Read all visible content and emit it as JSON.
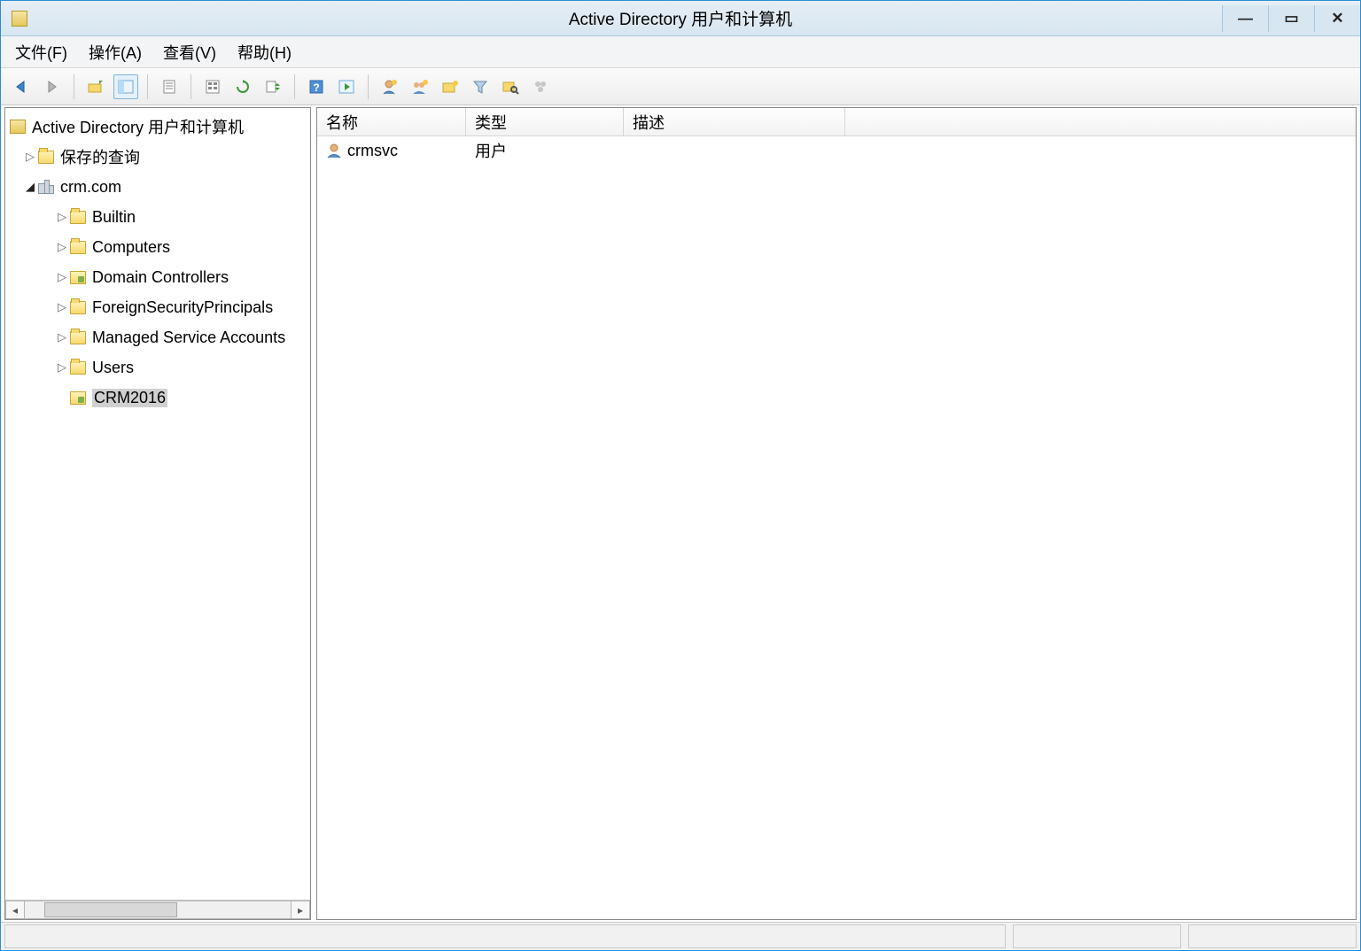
{
  "window": {
    "title": "Active Directory 用户和计算机"
  },
  "menu": {
    "file": "文件(F)",
    "action": "操作(A)",
    "view": "查看(V)",
    "help": "帮助(H)"
  },
  "tree": {
    "root": "Active Directory 用户和计算机",
    "savedQueries": "保存的查询",
    "domain": "crm.com",
    "nodes": {
      "builtin": "Builtin",
      "computers": "Computers",
      "domainControllers": "Domain Controllers",
      "fsp": "ForeignSecurityPrincipals",
      "msa": "Managed Service Accounts",
      "users": "Users",
      "crm2016": "CRM2016"
    }
  },
  "list": {
    "columns": {
      "name": "名称",
      "type": "类型",
      "desc": "描述"
    },
    "rows": [
      {
        "name": "crmsvc",
        "type": "用户",
        "desc": ""
      }
    ]
  },
  "toolbar_icons": {
    "back": "back-icon",
    "forward": "forward-icon",
    "up": "up-folder-icon",
    "show_hide": "show-hide-pane-icon",
    "properties": "properties-icon",
    "export_list": "export-list-icon",
    "refresh": "refresh-icon",
    "export": "export-icon",
    "help": "help-icon",
    "action_pane": "action-pane-icon",
    "new_user": "new-user-icon",
    "new_group": "new-group-icon",
    "new_ou": "new-ou-icon",
    "filter": "filter-icon",
    "find": "find-icon",
    "add_criteria": "add-criteria-icon"
  }
}
